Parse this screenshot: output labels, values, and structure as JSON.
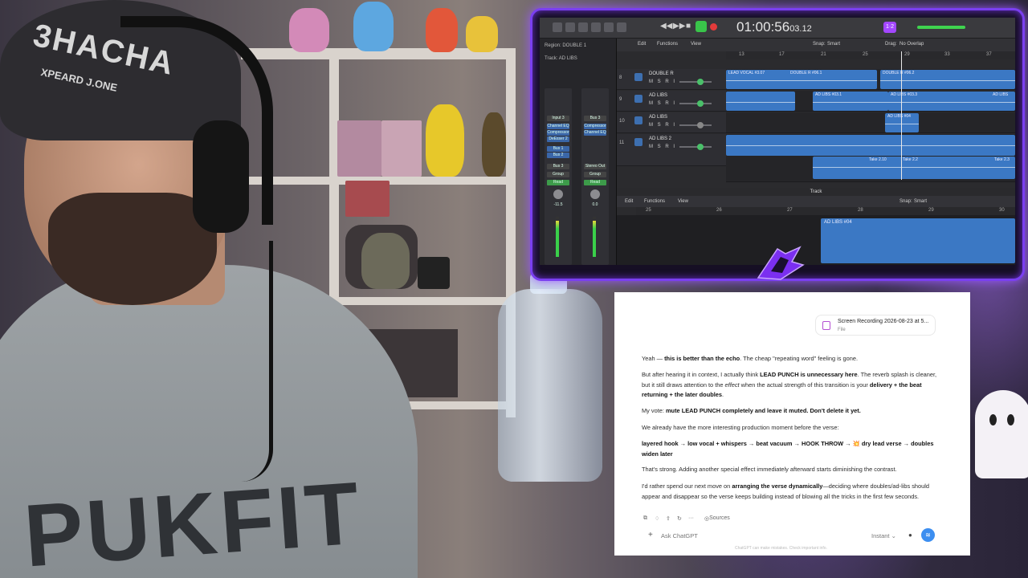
{
  "webcam": {
    "cap_text": "3HACHA",
    "cap_subtext": "XPEARD J.ONE",
    "hoodie_text": "PUKFIT"
  },
  "daw": {
    "lcd_time": "01:00:56",
    "lcd_subframes": "03.12",
    "region_label": "Region: DOUBLE 1",
    "track_label": "Track: AD LIBS",
    "menu": [
      "Edit",
      "Functions",
      "View"
    ],
    "snap_label": "Snap:",
    "snap_value": "Smart",
    "drag_label": "Drag:",
    "drag_value": "No Overlap",
    "ruler_marks": [
      "13",
      "17",
      "21",
      "25",
      "29",
      "33",
      "37"
    ],
    "tracks": [
      {
        "num": "8",
        "name": "DOUBLE R",
        "regions": [
          "LEAD VOCAL #3.07",
          "DOUBLE R #06.1",
          "DOUBLE R #06.2"
        ]
      },
      {
        "num": "9",
        "name": "AD LIBS",
        "regions": [
          "AD LIBS #03.1",
          "AD LIBS #03.3",
          "AD LIBS"
        ]
      },
      {
        "num": "10",
        "name": "AD LIBS",
        "regions": [
          "AD LIBS #04"
        ]
      },
      {
        "num": "11",
        "name": "AD LIBS 2",
        "regions": [
          "Take 2.10",
          "Take 2.2",
          "Take 2.3"
        ]
      }
    ],
    "inspector": {
      "slot_input": "Input 3",
      "slot_bus": "Bus 3",
      "plugin_1": "Channel EQ",
      "plugin_2": "Compressor",
      "plugin_3": "DeEsser 2",
      "send_1": "Bus 1",
      "send_2": "Bus 2",
      "stereo_out": "Stereo Out",
      "group": "Group",
      "read": "Read",
      "pan_a": "-11.5",
      "pan_b": "-10.2",
      "pan_c": "0.0",
      "pan_d": "-1.2"
    },
    "editor": {
      "title": "Track",
      "menu": [
        "Edit",
        "Functions",
        "View"
      ],
      "snap_label": "Snap:",
      "snap_value": "Smart",
      "ruler_marks": [
        "25",
        "26",
        "27",
        "28",
        "29",
        "30"
      ],
      "region": "AD LIBS #04"
    }
  },
  "chat": {
    "file": {
      "name": "Screen Recording 2026-08-23 at 5...",
      "type": "File"
    },
    "p1_a": "Yeah — ",
    "p1_b": "this is better than the echo",
    "p1_c": ". The cheap \"repeating word\" feeling is gone.",
    "p2_a": "But after hearing it in context, I actually think ",
    "p2_b": "LEAD PUNCH is unnecessary here",
    "p2_c": ". The reverb splash is cleaner, but it still draws attention to the ",
    "p2_d": "effect",
    "p2_e": " when the actual strength of this transition is your ",
    "p2_f": "delivery + the beat returning + the later doubles",
    "p2_g": ".",
    "p3_a": "My vote: ",
    "p3_b": "mute LEAD PUNCH completely and leave it muted. Don't delete it yet.",
    "p4": "We already have the more interesting production moment before the verse:",
    "p5": "layered hook → low vocal + whispers → beat vacuum → HOOK THROW → 💥 dry lead verse → doubles widen later",
    "p6": "That's strong. Adding another special effect immediately afterward starts diminishing the contrast.",
    "p7_a": "I'd rather spend our next move on ",
    "p7_b": "arranging the verse dynamically",
    "p7_c": "—deciding where doubles/ad-libs should appear and disappear so the verse keeps building instead of blowing all the tricks in the first few seconds.",
    "sources_label": "Sources",
    "composer_placeholder": "Ask ChatGPT",
    "mode_label": "Instant ⌄",
    "disclaimer": "ChatGPT can make mistakes. Check important info."
  }
}
